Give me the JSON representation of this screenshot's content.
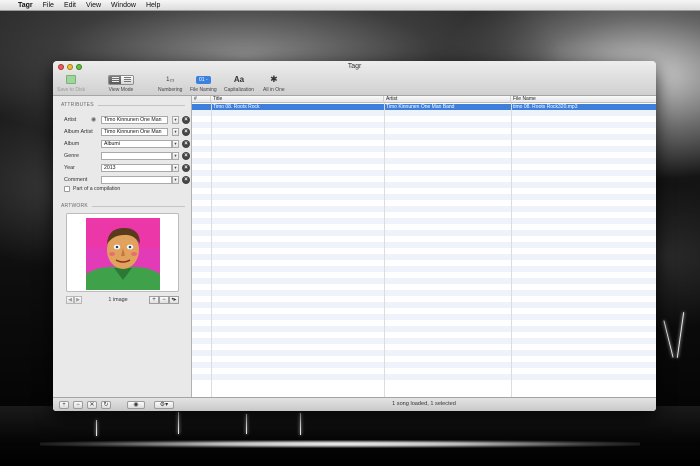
{
  "menubar": {
    "apple_glyph": "",
    "app_name": "Tagr",
    "items": [
      "File",
      "Edit",
      "View",
      "Window",
      "Help"
    ]
  },
  "window": {
    "title": "Tagr"
  },
  "toolbar": {
    "save_label": "Save to Disk",
    "view_mode_label": "View Mode",
    "numbering_label": "Numbering",
    "numbering_glyph": "1₂₃",
    "file_naming_label": "File Naming",
    "file_naming_badge": "01 -",
    "capitalization_label": "Capitalization",
    "capitalization_glyph": "Aa",
    "all_in_one_label": "All in One",
    "all_in_one_glyph": "✱"
  },
  "attributes": {
    "header": "ATTRIBUTES",
    "artist_label": "Artist",
    "artist_value": "Timo Kinnunen One Man",
    "album_artist_label": "Album Artist",
    "album_artist_value": "Timo Kinnunen One Man",
    "album_label": "Album",
    "album_value": "Albumi",
    "genre_label": "Genre",
    "genre_value": "",
    "year_label": "Year",
    "year_value": "2013",
    "comment_label": "Comment",
    "comment_value": "",
    "compilation_label": "Part of a compilation",
    "dropdown_glyph": "▾",
    "clear_glyph": "×",
    "eye_glyph": "◉"
  },
  "artwork": {
    "header": "ARTWORK",
    "count_label": "1 image",
    "prev_glyph": "◀",
    "next_glyph": "▶",
    "add_glyph": "+",
    "remove_glyph": "−",
    "more_glyph": "•▸"
  },
  "table": {
    "columns": [
      "#",
      "Title",
      "Artist",
      "File Name"
    ],
    "rows": [
      {
        "num": "",
        "title": "Timo 08. Roots Rock",
        "artist": "Timo Kinnunen One Man Band",
        "file_name": "timo 08. Roots Rock320.mp3"
      }
    ]
  },
  "bottombar": {
    "add_glyph": "+",
    "remove_glyph": "−",
    "close_glyph": "✕",
    "refresh_glyph": "↻",
    "eye_glyph": "◉",
    "gear_glyph": "⚙▾",
    "status": "1 song loaded, 1 selected"
  },
  "colors": {
    "selection": "#3f7fdc",
    "row_alt": "#eef3fb"
  }
}
